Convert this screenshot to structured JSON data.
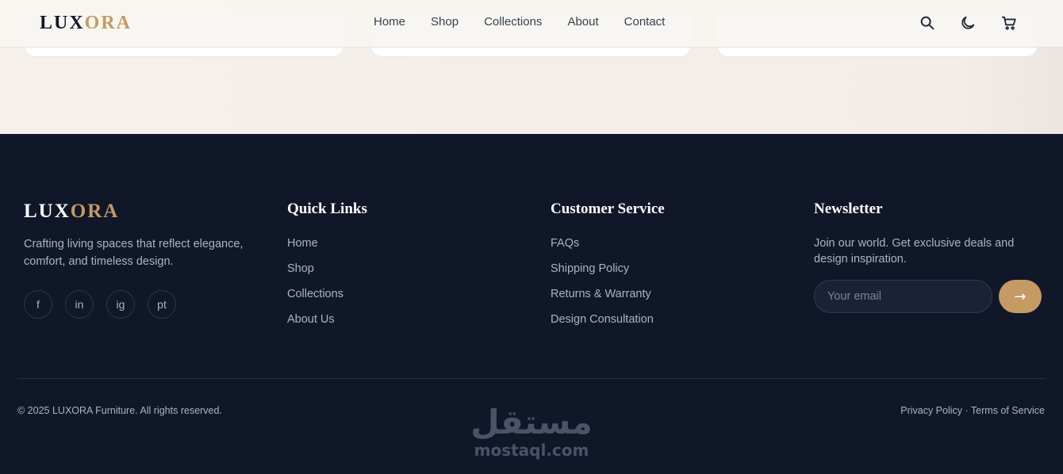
{
  "brand": {
    "part1": "LUX",
    "part2": "ORA",
    "accent_color": "#c59a63",
    "dark_color": "#0f172a"
  },
  "header": {
    "nav": [
      "Home",
      "Shop",
      "Collections",
      "About",
      "Contact"
    ],
    "icons": [
      "search-icon",
      "moon-icon",
      "cart-icon"
    ]
  },
  "footer": {
    "tagline": "Crafting living spaces that reflect elegance, comfort, and timeless design.",
    "socials": [
      "f",
      "in",
      "ig",
      "pt"
    ],
    "quick_links": {
      "title": "Quick Links",
      "items": [
        "Home",
        "Shop",
        "Collections",
        "About Us"
      ]
    },
    "customer_service": {
      "title": "Customer Service",
      "items": [
        "FAQs",
        "Shipping Policy",
        "Returns & Warranty",
        "Design Consultation"
      ]
    },
    "newsletter": {
      "title": "Newsletter",
      "text": "Join our world. Get exclusive deals and design inspiration.",
      "placeholder": "Your email",
      "button": "→"
    },
    "copyright": "© 2025 LUXORA Furniture. All rights reserved.",
    "legal": "Privacy Policy · Terms of Service",
    "background_color": "#101729"
  },
  "watermark": {
    "arabic": "مستقل",
    "latin": "mostaql.com"
  }
}
